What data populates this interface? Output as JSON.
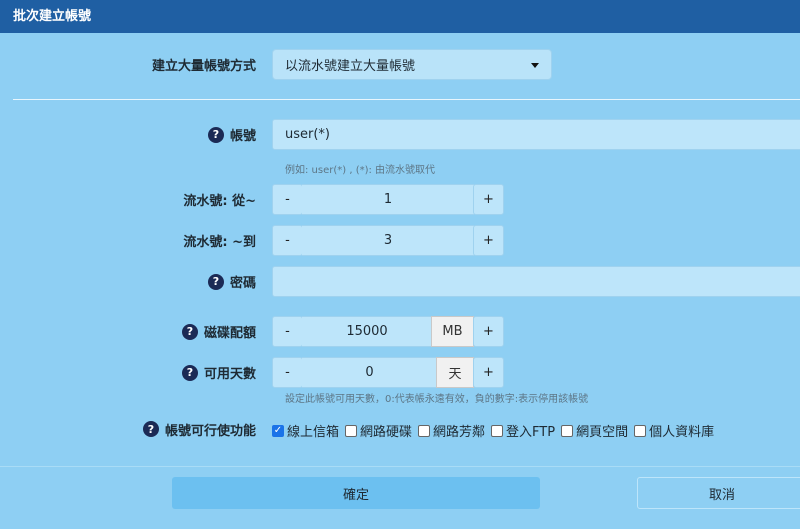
{
  "dialog": {
    "title": "批次建立帳號"
  },
  "method": {
    "label": "建立大量帳號方式",
    "selected": "以流水號建立大量帳號"
  },
  "account": {
    "label": "帳號",
    "value": "user(*)",
    "hint": "例如: user(*) , (*): 由流水號取代"
  },
  "serial_from": {
    "label": "流水號: 從~",
    "minus": "-",
    "value": "1",
    "plus": "+"
  },
  "serial_to": {
    "label": "流水號: ~到",
    "minus": "-",
    "value": "3",
    "plus": "+"
  },
  "password": {
    "label": "密碼",
    "value": ""
  },
  "quota": {
    "label": "磁碟配額",
    "minus": "-",
    "value": "15000",
    "unit": "MB",
    "plus": "+"
  },
  "days": {
    "label": "可用天數",
    "minus": "-",
    "value": "0",
    "unit": "天",
    "plus": "+",
    "hint": "設定此帳號可用天數，0:代表帳永遠有效，負的數字:表示停用該帳號"
  },
  "permissions": {
    "label": "帳號可行使功能",
    "items": [
      {
        "label": "線上信箱",
        "checked": true
      },
      {
        "label": "網路硬碟",
        "checked": false
      },
      {
        "label": "網路芳鄰",
        "checked": false
      },
      {
        "label": "登入FTP",
        "checked": false
      },
      {
        "label": "網頁空間",
        "checked": false
      },
      {
        "label": "個人資料庫",
        "checked": false
      }
    ]
  },
  "footer": {
    "ok_label": "確定",
    "cancel_label": "取消"
  },
  "help_glyph": "?"
}
